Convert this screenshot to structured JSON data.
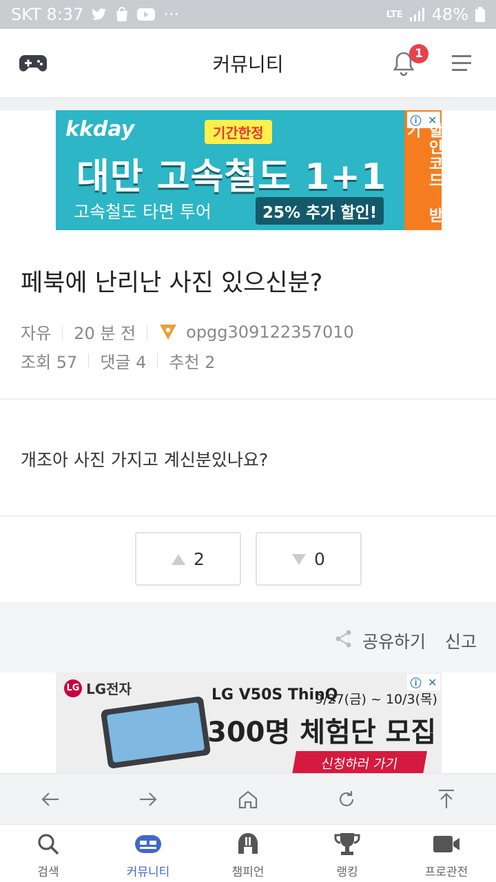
{
  "status_bar": {
    "carrier_time": "SKT 8:37",
    "battery": "48%",
    "dots": "···",
    "network": "LTE"
  },
  "header": {
    "title": "커뮤니티",
    "notification_count": "1"
  },
  "ad_top": {
    "brand": "kkday",
    "tag": "기간한정",
    "headline": "대만 고속철도 1+1",
    "subline": "고속철도 타면 투어",
    "badge": "25% 추가 할인!",
    "side_cta": "할인코드 받기"
  },
  "post": {
    "title": "페북에 난리난 사진 있으신분?",
    "category": "자유",
    "time": "20 분 전",
    "author": "opgg309122357010",
    "views": "조회 57",
    "comments": "댓글 4",
    "recommend": "추천 2",
    "body": "개조아 사진 가지고 계신분있나요?"
  },
  "votes": {
    "up_count": "2",
    "down_count": "0"
  },
  "actions": {
    "share": "공유하기",
    "report": "신고"
  },
  "ad_bottom": {
    "brand": "LG전자",
    "logo_text": "LG",
    "model": "LG V50S ThinQ",
    "dates": "9/27(금) ~ 10/3(목)",
    "headline": "300명 체험단 모집",
    "cta": "신청하러 가기"
  },
  "bottom_nav": [
    {
      "label": "검색",
      "icon": "search-icon",
      "active": false
    },
    {
      "label": "커뮤니티",
      "icon": "community-icon",
      "active": true
    },
    {
      "label": "챔피언",
      "icon": "champion-icon",
      "active": false
    },
    {
      "label": "랭킹",
      "icon": "trophy-icon",
      "active": false
    },
    {
      "label": "프로관전",
      "icon": "video-camera-icon",
      "active": false
    }
  ],
  "colors": {
    "accent": "#4367c8",
    "badge_red": "#e8424a",
    "status_bar": "#c9ccd1"
  }
}
